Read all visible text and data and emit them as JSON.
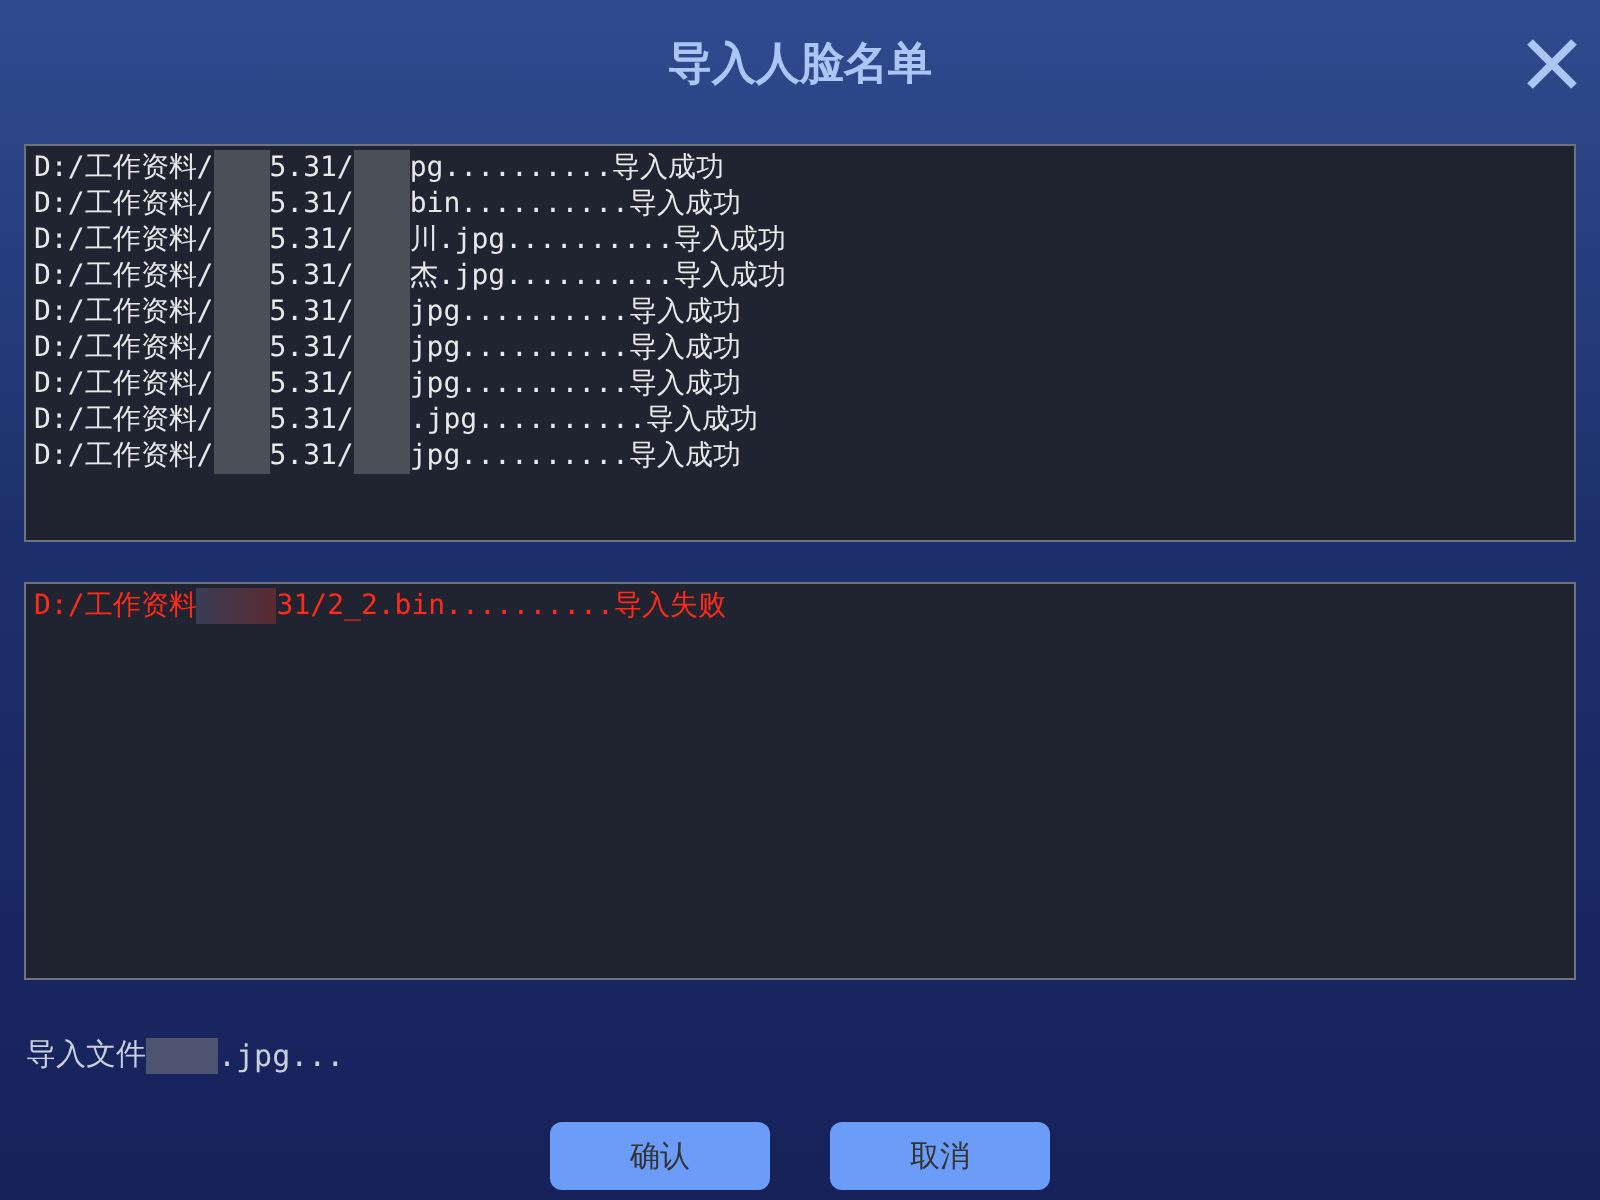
{
  "window": {
    "title": "导入人脸名单"
  },
  "success_log": [
    {
      "parts": [
        "D:/工作资料/",
        "5.31/",
        "pg..........导入成功"
      ]
    },
    {
      "parts": [
        "D:/工作资料/",
        "5.31/",
        "bin..........导入成功"
      ]
    },
    {
      "parts": [
        "D:/工作资料/",
        "5.31/",
        "川.jpg..........导入成功"
      ]
    },
    {
      "parts": [
        "D:/工作资料/",
        "5.31/",
        "杰.jpg..........导入成功"
      ]
    },
    {
      "parts": [
        "D:/工作资料/",
        "5.31/",
        "jpg..........导入成功"
      ]
    },
    {
      "parts": [
        "D:/工作资料/",
        "5.31/",
        "jpg..........导入成功"
      ]
    },
    {
      "parts": [
        "D:/工作资料/",
        "5.31/",
        "jpg..........导入成功"
      ]
    },
    {
      "parts": [
        "D:/工作资料/",
        "5.31/",
        ".jpg..........导入成功"
      ]
    },
    {
      "parts": [
        "D:/工作资料/",
        "5.31/",
        "jpg..........导入成功"
      ]
    }
  ],
  "failure_log": [
    {
      "parts": [
        "D:/工作资料",
        "31/2_2.bin..........导入失败"
      ]
    }
  ],
  "status": {
    "parts": [
      "导入文件",
      ".jpg..."
    ]
  },
  "buttons": [
    "确认",
    "取消"
  ]
}
